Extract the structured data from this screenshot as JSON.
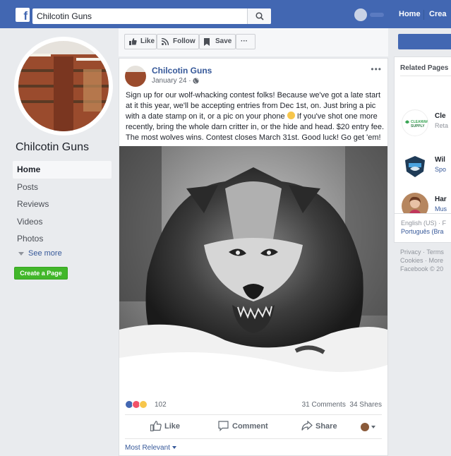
{
  "topbar": {
    "logo": "f",
    "search_value": "Chilcotin Guns",
    "nav_home": "Home",
    "nav_create": "Crea",
    "icons": {
      "logo": "facebook-logo-icon",
      "search": "search-icon"
    }
  },
  "page": {
    "name": "Chilcotin Guns",
    "menu": [
      "Home",
      "Posts",
      "Reviews",
      "Videos",
      "Photos"
    ],
    "see_more": "See more",
    "create_page": "Create a Page"
  },
  "actions": {
    "like": "Like",
    "follow": "Follow",
    "save": "Save",
    "more": "···"
  },
  "post": {
    "author": "Chilcotin Guns",
    "date": "January 24 ·",
    "text_part1": "Sign up for our wolf-whacking contest folks! Because we've got a late start at it this year, we'll be accepting entries from Dec 1st, on. Just bring a pic with a date stamp on it, or a pic on your phone",
    "text_part2": "If you've shot one more recently, bring the whole darn critter in, or the hide and head. $20 entry fee. The most wolves wins. Contest closes March 31st. Good luck! Go get 'em!",
    "menu_dots": "•••",
    "reaction_count": "102",
    "comments": "31 Comments",
    "shares": "34 Shares",
    "btn_like": "Like",
    "btn_comment": "Comment",
    "btn_share": "Share",
    "most_relevant": "Most Relevant",
    "reaction_colors": {
      "like": "#4267b2",
      "love": "#f25268",
      "haha": "#f7c64b"
    }
  },
  "right": {
    "related_title": "Related Pages",
    "related": [
      {
        "name": "Cle",
        "sub": "Reta",
        "logo_text": "CLEANWAY\nSUPPLY"
      },
      {
        "name": "Wil",
        "sub": "Spo"
      },
      {
        "name": "Har",
        "sub": "Mus"
      }
    ],
    "lang1": "English (US) · F",
    "lang2": "Português (Bra",
    "legal1": "Privacy · Terms",
    "legal2": "Cookies · More",
    "legal3": "Facebook © 20"
  }
}
